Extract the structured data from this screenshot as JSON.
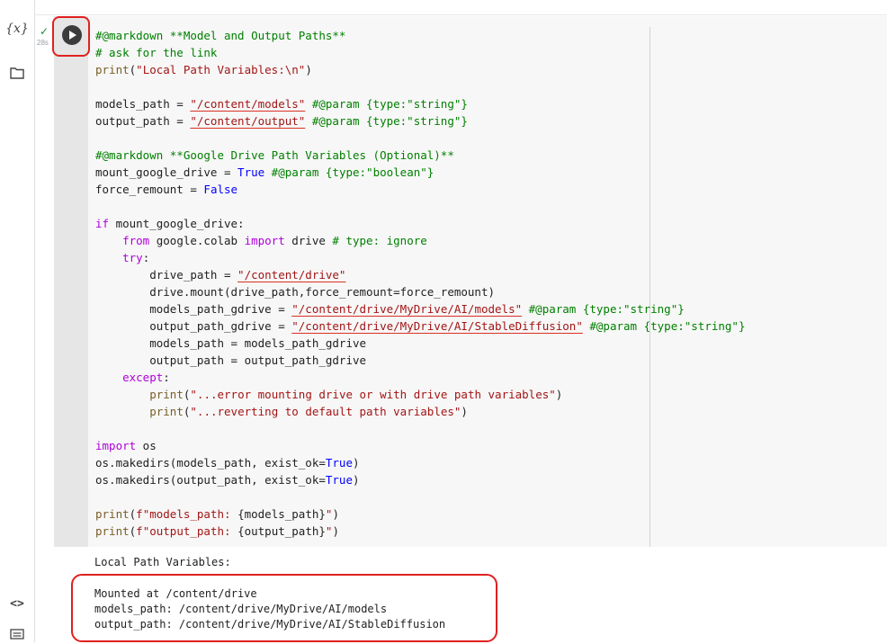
{
  "rail": {
    "variables_icon_text": "{x}",
    "code_icon_text": "<>"
  },
  "cell_status": {
    "check": "✓",
    "exec_time": "28s"
  },
  "code_lines": [
    [
      {
        "t": "#@markdown **Model and Output Paths**",
        "c": "comment"
      }
    ],
    [
      {
        "t": "# ask for the link",
        "c": "comment"
      }
    ],
    [
      {
        "t": "print",
        "c": "fn"
      },
      {
        "t": "(",
        "c": ""
      },
      {
        "t": "\"Local Path Variables:\\n\"",
        "c": "string"
      },
      {
        "t": ")",
        "c": ""
      }
    ],
    [],
    [
      {
        "t": "models_path = ",
        "c": ""
      },
      {
        "t": "\"/content/models\"",
        "c": "string",
        "u": true
      },
      {
        "t": " #@param {type:\"string\"}",
        "c": "comment"
      }
    ],
    [
      {
        "t": "output_path = ",
        "c": ""
      },
      {
        "t": "\"/content/output\"",
        "c": "string",
        "u": true
      },
      {
        "t": " #@param {type:\"string\"}",
        "c": "comment"
      }
    ],
    [],
    [
      {
        "t": "#@markdown **Google Drive Path Variables (Optional)**",
        "c": "comment"
      }
    ],
    [
      {
        "t": "mount_google_drive = ",
        "c": ""
      },
      {
        "t": "True",
        "c": "const"
      },
      {
        "t": " #@param {type:\"boolean\"}",
        "c": "comment"
      }
    ],
    [
      {
        "t": "force_remount = ",
        "c": ""
      },
      {
        "t": "False",
        "c": "const"
      }
    ],
    [],
    [
      {
        "t": "if",
        "c": "kw"
      },
      {
        "t": " mount_google_drive:",
        "c": ""
      }
    ],
    [
      {
        "t": "    ",
        "c": ""
      },
      {
        "t": "from",
        "c": "kw"
      },
      {
        "t": " google.colab ",
        "c": ""
      },
      {
        "t": "import",
        "c": "kw"
      },
      {
        "t": " drive ",
        "c": ""
      },
      {
        "t": "# type: ignore",
        "c": "comment"
      }
    ],
    [
      {
        "t": "    ",
        "c": ""
      },
      {
        "t": "try",
        "c": "kw"
      },
      {
        "t": ":",
        "c": ""
      }
    ],
    [
      {
        "t": "        drive_path = ",
        "c": ""
      },
      {
        "t": "\"/content/drive\"",
        "c": "string",
        "u": true
      }
    ],
    [
      {
        "t": "        drive.mount(drive_path,force_remount=force_remount)",
        "c": ""
      }
    ],
    [
      {
        "t": "        models_path_gdrive = ",
        "c": ""
      },
      {
        "t": "\"/content/drive/MyDrive/AI/models\"",
        "c": "string",
        "u": true
      },
      {
        "t": " #@param {type:\"string\"}",
        "c": "comment"
      }
    ],
    [
      {
        "t": "        output_path_gdrive = ",
        "c": ""
      },
      {
        "t": "\"/content/drive/MyDrive/AI/StableDiffusion\"",
        "c": "string",
        "u": true
      },
      {
        "t": " #@param {type:\"string\"}",
        "c": "comment"
      }
    ],
    [
      {
        "t": "        models_path = models_path_gdrive",
        "c": ""
      }
    ],
    [
      {
        "t": "        output_path = output_path_gdrive",
        "c": ""
      }
    ],
    [
      {
        "t": "    ",
        "c": ""
      },
      {
        "t": "except",
        "c": "kw"
      },
      {
        "t": ":",
        "c": ""
      }
    ],
    [
      {
        "t": "        ",
        "c": ""
      },
      {
        "t": "print",
        "c": "fn"
      },
      {
        "t": "(",
        "c": ""
      },
      {
        "t": "\"...error mounting drive or with drive path variables\"",
        "c": "string"
      },
      {
        "t": ")",
        "c": ""
      }
    ],
    [
      {
        "t": "        ",
        "c": ""
      },
      {
        "t": "print",
        "c": "fn"
      },
      {
        "t": "(",
        "c": ""
      },
      {
        "t": "\"...reverting to default path variables\"",
        "c": "string"
      },
      {
        "t": ")",
        "c": ""
      }
    ],
    [],
    [
      {
        "t": "import",
        "c": "kw"
      },
      {
        "t": " os",
        "c": ""
      }
    ],
    [
      {
        "t": "os.makedirs(models_path, exist_ok=",
        "c": ""
      },
      {
        "t": "True",
        "c": "const"
      },
      {
        "t": ")",
        "c": ""
      }
    ],
    [
      {
        "t": "os.makedirs(output_path, exist_ok=",
        "c": ""
      },
      {
        "t": "True",
        "c": "const"
      },
      {
        "t": ")",
        "c": ""
      }
    ],
    [],
    [
      {
        "t": "print",
        "c": "fn"
      },
      {
        "t": "(",
        "c": ""
      },
      {
        "t": "f\"models_path: ",
        "c": "string"
      },
      {
        "t": "{models_path}",
        "c": ""
      },
      {
        "t": "\"",
        "c": "string"
      },
      {
        "t": ")",
        "c": ""
      }
    ],
    [
      {
        "t": "print",
        "c": "fn"
      },
      {
        "t": "(",
        "c": ""
      },
      {
        "t": "f\"output_path: ",
        "c": "string"
      },
      {
        "t": "{output_path}",
        "c": ""
      },
      {
        "t": "\"",
        "c": "string"
      },
      {
        "t": ")",
        "c": ""
      }
    ]
  ],
  "output": {
    "line1": "Local Path Variables:",
    "mount": "Mounted at /content/drive",
    "models": "models_path: /content/drive/MyDrive/AI/models",
    "outpath": "output_path: /content/drive/MyDrive/AI/StableDiffusion"
  }
}
